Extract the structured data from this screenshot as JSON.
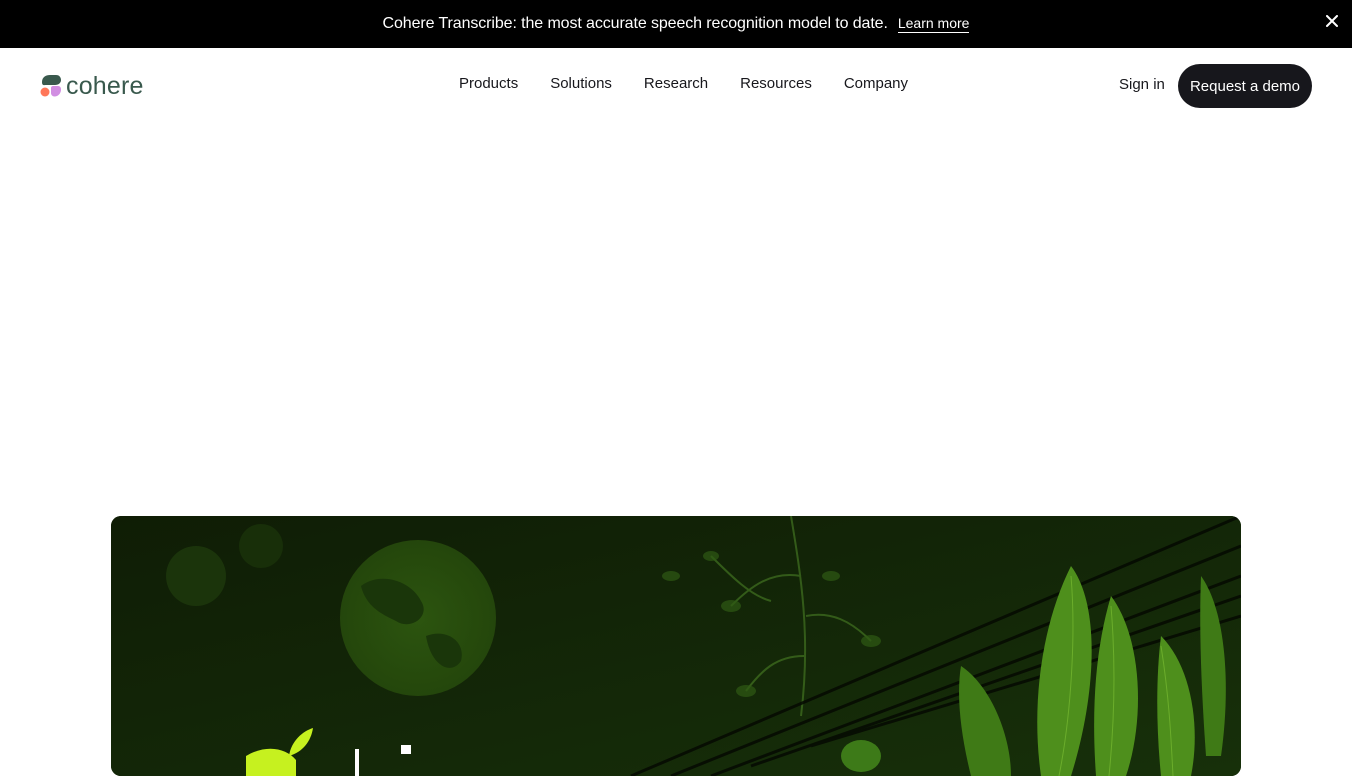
{
  "banner": {
    "text": "Cohere Transcribe: the most accurate speech recognition model to date.",
    "link_label": "Learn more",
    "close_icon": "close-icon"
  },
  "header": {
    "logo_text": "cohere",
    "nav": [
      {
        "label": "Products"
      },
      {
        "label": "Solutions"
      },
      {
        "label": "Research"
      },
      {
        "label": "Resources"
      },
      {
        "label": "Company"
      }
    ],
    "sign_in": "Sign in",
    "cta": "Request a demo"
  },
  "colors": {
    "banner_bg": "#000000",
    "logo_green": "#39594d",
    "cta_bg": "#17171c",
    "card_bg": "#122206",
    "leaf_green": "#5fa82a",
    "lime": "#c6f11f"
  },
  "hero": {
    "image": "green-foliage-illustration"
  }
}
